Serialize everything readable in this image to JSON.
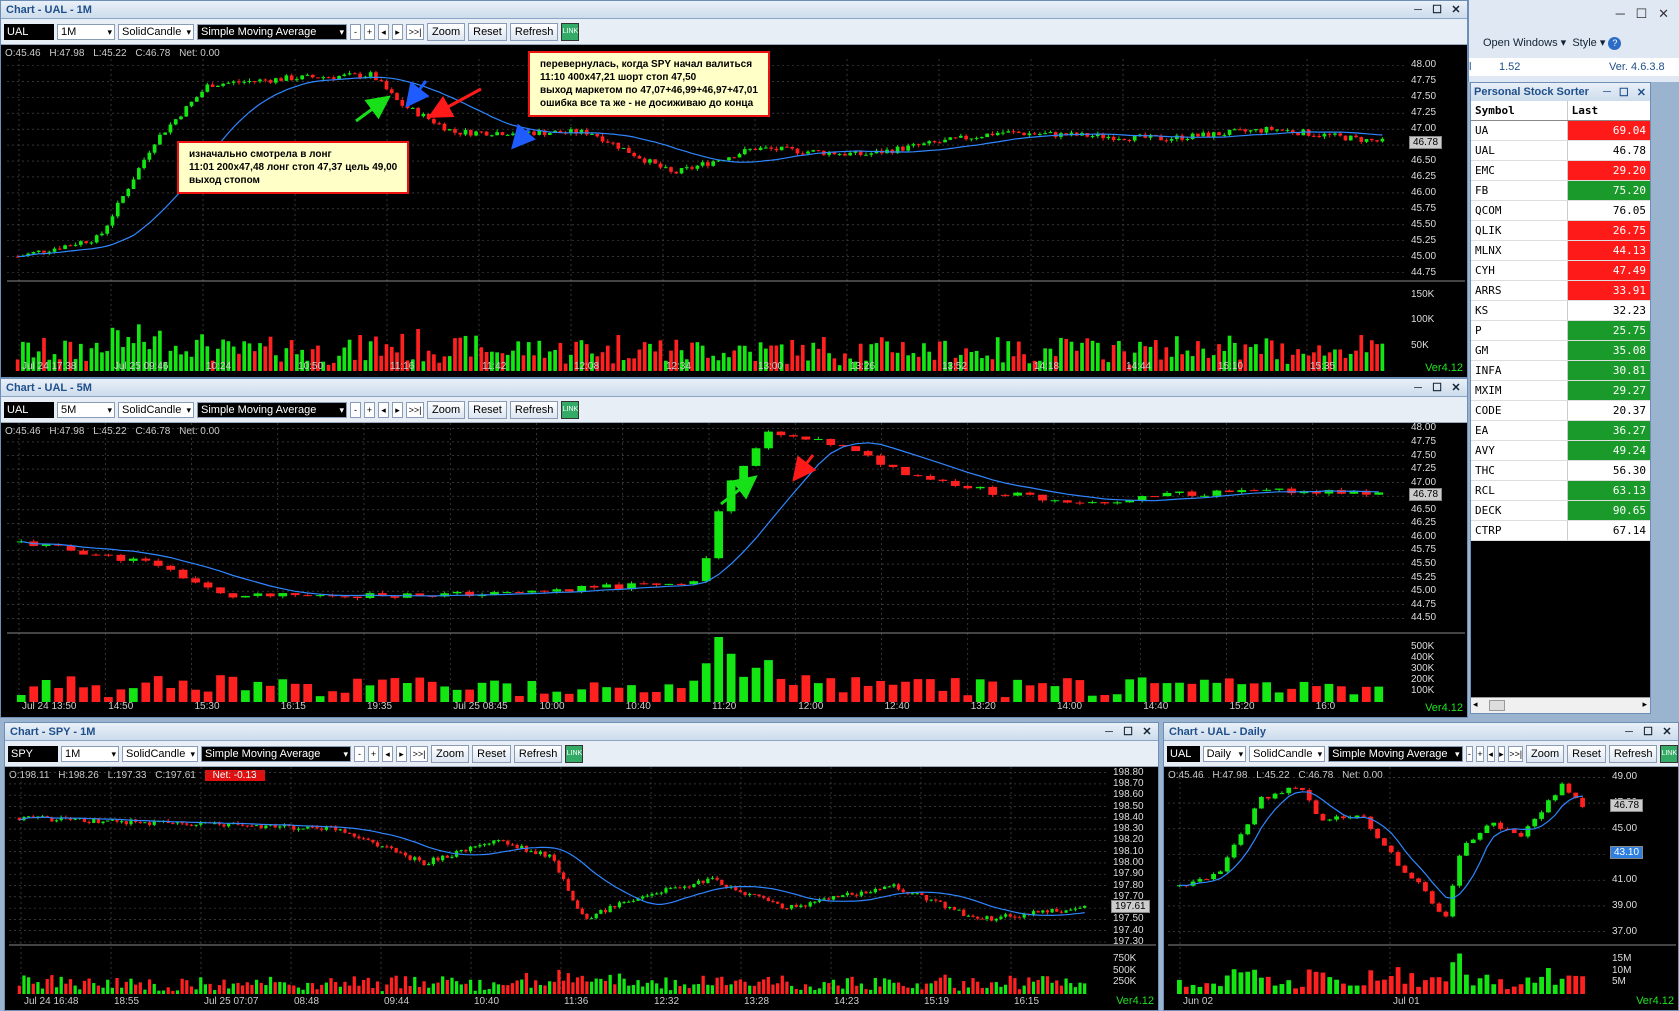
{
  "right_panel": {
    "open_windows": "Open Windows",
    "style": "Style",
    "field1": "1.52",
    "version": "Ver. 4.6.3.8"
  },
  "sorter": {
    "title": "Personal Stock Sorter",
    "col_symbol": "Symbol",
    "col_last": "Last",
    "rows": [
      {
        "s": "UA",
        "v": "69.04",
        "c": "red"
      },
      {
        "s": "UAL",
        "v": "46.78",
        "c": "white"
      },
      {
        "s": "EMC",
        "v": "29.20",
        "c": "red"
      },
      {
        "s": "FB",
        "v": "75.20",
        "c": "green"
      },
      {
        "s": "QCOM",
        "v": "76.05",
        "c": "white"
      },
      {
        "s": "QLIK",
        "v": "26.75",
        "c": "red"
      },
      {
        "s": "MLNX",
        "v": "44.13",
        "c": "red"
      },
      {
        "s": "CYH",
        "v": "47.49",
        "c": "red"
      },
      {
        "s": "ARRS",
        "v": "33.91",
        "c": "red"
      },
      {
        "s": "KS",
        "v": "32.23",
        "c": "white"
      },
      {
        "s": "P",
        "v": "25.75",
        "c": "green"
      },
      {
        "s": "GM",
        "v": "35.08",
        "c": "green"
      },
      {
        "s": "INFA",
        "v": "30.81",
        "c": "green"
      },
      {
        "s": "MXIM",
        "v": "29.27",
        "c": "green"
      },
      {
        "s": "CODE",
        "v": "20.37",
        "c": "white"
      },
      {
        "s": "EA",
        "v": "36.27",
        "c": "green"
      },
      {
        "s": "AVY",
        "v": "49.24",
        "c": "green"
      },
      {
        "s": "THC",
        "v": "56.30",
        "c": "white"
      },
      {
        "s": "RCL",
        "v": "63.13",
        "c": "green"
      },
      {
        "s": "DECK",
        "v": "90.65",
        "c": "green"
      },
      {
        "s": "CTRP",
        "v": "67.14",
        "c": "white"
      }
    ]
  },
  "charts": [
    {
      "id": "c1",
      "title": "Chart - UAL - 1M",
      "symbol": "UAL",
      "interval": "1M",
      "style": "SolidCandle",
      "indicator": "Simple Moving Average",
      "ohlc": {
        "o": "O:45.46",
        "h": "H:47.98",
        "l": "L:45.22",
        "c": "C:46.78",
        "net": "Net: 0.00"
      },
      "prices": [
        "48.00",
        "47.75",
        "47.50",
        "47.25",
        "47.00",
        "46.75",
        "46.50",
        "46.25",
        "46.00",
        "45.75",
        "45.50",
        "45.25",
        "45.00",
        "44.75"
      ],
      "vol": [
        "150K",
        "100K",
        "50K"
      ],
      "last": "46.78",
      "times": [
        "Jul 24 17:38",
        "Jul 25 09:46",
        "10:24",
        "10:50",
        "11:16",
        "11:42",
        "12:08",
        "12:34",
        "13:00",
        "13:26",
        "13:52",
        "14:18",
        "14:44",
        "15:10",
        "15:35"
      ],
      "ver": "Ver4.12"
    },
    {
      "id": "c2",
      "title": "Chart - UAL - 5M",
      "symbol": "UAL",
      "interval": "5M",
      "style": "SolidCandle",
      "indicator": "Simple Moving Average",
      "ohlc": {
        "o": "O:45.46",
        "h": "H:47.98",
        "l": "L:45.22",
        "c": "C:46.78",
        "net": "Net: 0.00"
      },
      "prices": [
        "48.00",
        "47.75",
        "47.50",
        "47.25",
        "47.00",
        "46.75",
        "46.50",
        "46.25",
        "46.00",
        "45.75",
        "45.50",
        "45.25",
        "45.00",
        "44.75",
        "44.50"
      ],
      "vol": [
        "500K",
        "400K",
        "300K",
        "200K",
        "100K"
      ],
      "last": "46.78",
      "times": [
        "Jul 24 13:50",
        "14:50",
        "15:30",
        "16:15",
        "19:35",
        "Jul 25 08:45",
        "10:00",
        "10:40",
        "11:20",
        "12:00",
        "12:40",
        "13:20",
        "14:00",
        "14:40",
        "15:20",
        "16:0"
      ],
      "ver": "Ver4.12"
    },
    {
      "id": "c3",
      "title": "Chart - SPY - 1M",
      "symbol": "SPY",
      "interval": "1M",
      "style": "SolidCandle",
      "indicator": "Simple Moving Average",
      "ohlc": {
        "o": "O:198.11",
        "h": "H:198.26",
        "l": "L:197.33",
        "c": "C:197.61",
        "net": "Net: -0.13"
      },
      "prices": [
        "198.80",
        "198.70",
        "198.60",
        "198.50",
        "198.40",
        "198.30",
        "198.20",
        "198.10",
        "198.00",
        "197.90",
        "197.80",
        "197.70",
        "197.60",
        "197.50",
        "197.40",
        "197.30"
      ],
      "vol": [
        "750K",
        "500K",
        "250K"
      ],
      "last": "197.61",
      "times": [
        "Jul 24 16:48",
        "18:55",
        "Jul 25 07:07",
        "08:48",
        "09:44",
        "10:40",
        "11:36",
        "12:32",
        "13:28",
        "14:23",
        "15:19",
        "16:15"
      ],
      "ver": "Ver4.12"
    },
    {
      "id": "c4",
      "title": "Chart - UAL - Daily",
      "symbol": "UAL",
      "interval": "Daily",
      "style": "SolidCandle",
      "indicator": "Simple Moving Average",
      "ohlc": {
        "o": "O:45.46",
        "h": "H:47.98",
        "l": "L:45.22",
        "c": "C:46.78",
        "net": "Net: 0.00"
      },
      "prices": [
        "49.00",
        "47.00",
        "45.00",
        "43.00",
        "41.00",
        "39.00",
        "37.00"
      ],
      "vol": [
        "15M",
        "10M",
        "5M"
      ],
      "last": "46.78",
      "last2": "43.10",
      "times": [
        "Jun 02",
        "Jul 01"
      ],
      "ver": "Ver4.12"
    }
  ],
  "toolbar": {
    "zoom": "Zoom",
    "reset": "Reset",
    "refresh": "Refresh",
    "link": "LINK"
  },
  "notes": {
    "n1": [
      "изначально смотрела в лонг",
      "11:01 200x47,48 лонг   стоп 47,37   цель 49,00",
      "выход стопом"
    ],
    "n2": [
      "перевернулась, когда SPY начал валиться",
      "11:10  400x47,21 шорт  стоп 47,50",
      "выход маркетом по 47,07+46,99+46,97+47,01",
      "ошибка все та же - не досиживаю до конца"
    ]
  }
}
